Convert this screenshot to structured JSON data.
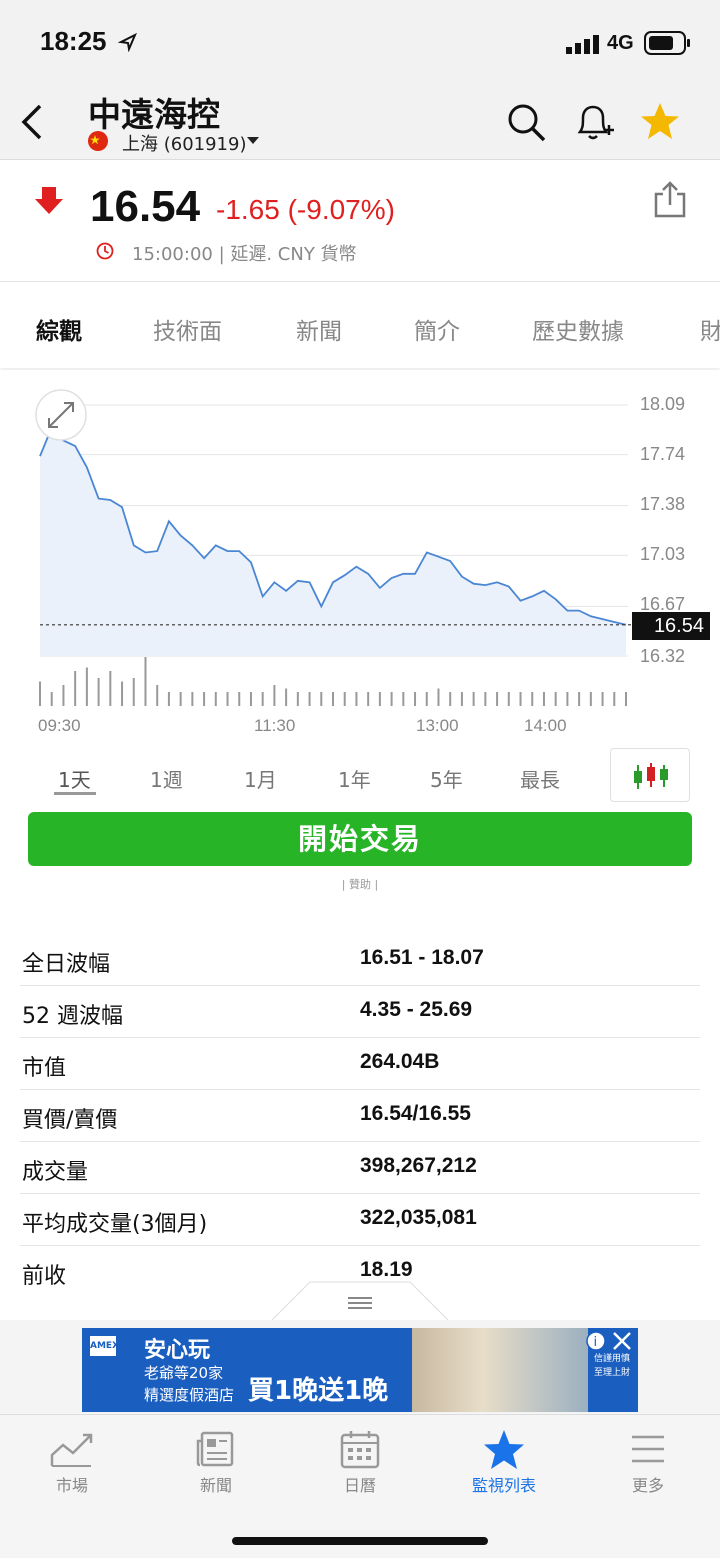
{
  "status": {
    "time": "18:25",
    "network": "4G"
  },
  "header": {
    "title": "中遠海控",
    "exchange": "上海 (601919)"
  },
  "quote": {
    "price": "16.54",
    "change": "-1.65 (-9.07%)",
    "meta": "15:00:00 | 延遲. CNY 貨幣",
    "direction": "down",
    "down_color": "#e02020"
  },
  "tabs": [
    "綜觀",
    "技術面",
    "新聞",
    "簡介",
    "歷史數據",
    "財"
  ],
  "chart_data": {
    "type": "area",
    "y_ticks": [
      "18.09",
      "17.74",
      "17.38",
      "17.03",
      "16.67",
      "16.32"
    ],
    "x_ticks": [
      "09:30",
      "11:30",
      "13:00",
      "14:00"
    ],
    "last_price": "16.54",
    "reference_price": 16.54,
    "ylim": [
      16.32,
      18.09
    ],
    "grid": true,
    "line_color": "#4a86d4",
    "series": [
      {
        "values": [
          17.73,
          17.93,
          17.84,
          17.8,
          17.65,
          17.43,
          17.42,
          17.37,
          17.1,
          17.05,
          17.06,
          17.27,
          17.17,
          17.1,
          17.01,
          17.1,
          17.06,
          17.06,
          16.98,
          16.74,
          16.84,
          16.78,
          16.85,
          16.84,
          16.67,
          16.84,
          16.89,
          16.95,
          16.9,
          16.8,
          16.87,
          16.9,
          16.9,
          17.05,
          17.02,
          16.99,
          16.88,
          16.83,
          16.82,
          16.84,
          16.81,
          16.71,
          16.74,
          16.78,
          16.72,
          16.64,
          16.64,
          16.6,
          16.58,
          16.56,
          16.54
        ]
      },
      {
        "values": [
          0.35,
          0.2,
          0.3,
          0.5,
          0.55,
          0.4,
          0.5,
          0.35,
          0.4,
          0.7,
          0.3,
          0.2,
          0.2,
          0.2,
          0.2,
          0.2,
          0.2,
          0.2,
          0.2,
          0.2,
          0.3,
          0.25,
          0.2,
          0.2,
          0.2,
          0.2,
          0.2,
          0.2,
          0.2,
          0.2,
          0.2,
          0.2,
          0.2,
          0.2,
          0.25,
          0.2,
          0.2,
          0.2,
          0.2,
          0.2,
          0.2,
          0.2,
          0.2,
          0.2,
          0.2,
          0.2,
          0.2,
          0.2,
          0.2,
          0.2,
          0.2
        ]
      }
    ]
  },
  "ranges": [
    "1天",
    "1週",
    "1月",
    "1年",
    "5年",
    "最長"
  ],
  "trade_button": "開始交易",
  "sponsor": "| 贊助 |",
  "stats": [
    {
      "k": "全日波幅",
      "v": "16.51 - 18.07"
    },
    {
      "k": "52 週波幅",
      "v": "4.35 - 25.69"
    },
    {
      "k": "市值",
      "v": "264.04B"
    },
    {
      "k": "買價/賣價",
      "v": "16.54/16.55"
    },
    {
      "k": "成交量",
      "v": "398,267,212"
    },
    {
      "k": "平均成交量(3個月)",
      "v": "322,035,081"
    },
    {
      "k": "前收",
      "v": "18.19"
    }
  ],
  "ad": {
    "brand": "安心玩",
    "line1": "老爺等20家",
    "line2": "精選度假酒店",
    "offer": "買1晚送1晚",
    "note": "信謹用慎至理上財"
  },
  "tabbar": [
    {
      "label": "市場",
      "icon": "chart-icon"
    },
    {
      "label": "新聞",
      "icon": "newspaper-icon"
    },
    {
      "label": "日曆",
      "icon": "calendar-icon"
    },
    {
      "label": "監視列表",
      "icon": "star-icon"
    },
    {
      "label": "更多",
      "icon": "menu-icon"
    }
  ]
}
